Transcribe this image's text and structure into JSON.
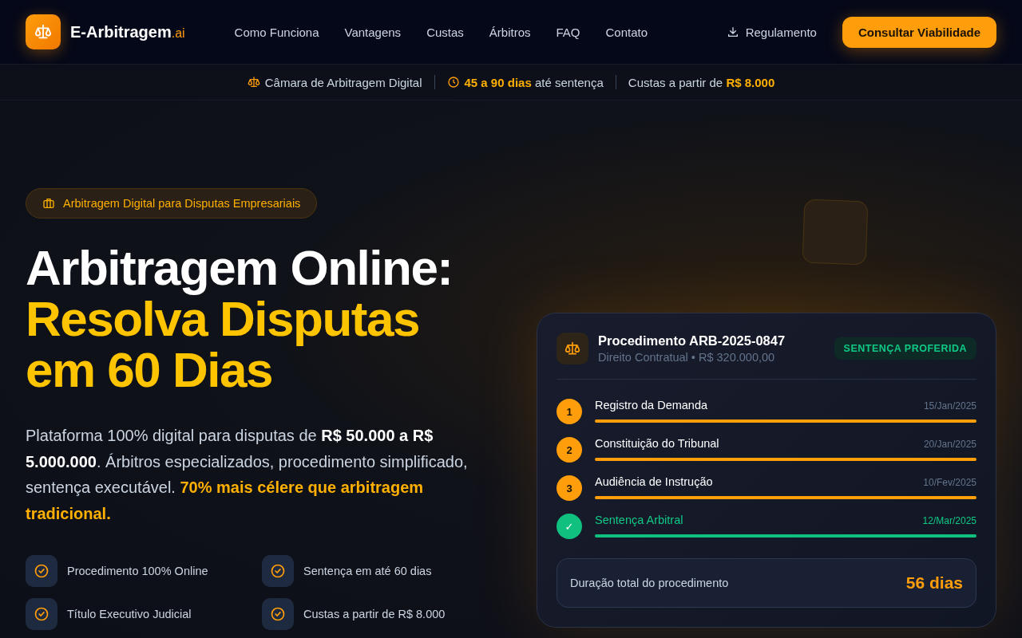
{
  "brand": {
    "name": "E-Arbitragem",
    "suffix": ".ai"
  },
  "nav": [
    {
      "label": "Como Funciona"
    },
    {
      "label": "Vantagens"
    },
    {
      "label": "Custas"
    },
    {
      "label": "Árbitros"
    },
    {
      "label": "FAQ"
    },
    {
      "label": "Contato"
    }
  ],
  "download_link": "Regulamento",
  "cta_button": "Consultar Viabilidade",
  "info_bar": [
    {
      "kind": "scale",
      "text": "Câmara de Arbitragem Digital"
    },
    {
      "kind": "clock",
      "text": "**45 a 90 dias** até sentença"
    },
    {
      "kind": "plain",
      "text": "Custas a partir de **R$ 8.000**"
    }
  ],
  "hero": {
    "badge": "Arbitragem Digital para Disputas Empresariais",
    "title_line": "Arbitragem Online:",
    "title_highlight": "Resolva Disputas em 60 Dias",
    "description": "Plataforma 100% digital para disputas de **R$ 50.000 a R$ 5.000.000**. Árbitros especializados, procedimento simplificado, sentença executável. **70% mais célere que arbitragem tradicional.**",
    "features": [
      {
        "label": "Procedimento 100% Online"
      },
      {
        "label": "Sentença em até 60 dias"
      },
      {
        "label": "Título Executivo Judicial"
      },
      {
        "label": "Custas a partir de R$ 8.000"
      }
    ]
  },
  "case_card": {
    "title": "Procedimento ARB-2025-0847",
    "subtitle": "Direito Contratual • R$ 320.000,00",
    "status": "SENTENÇA PROFERIDA",
    "steps": [
      {
        "kind": "number",
        "marker": "1",
        "label": "Registro da Demanda",
        "date": "15/Jan/2025",
        "level": 1
      },
      {
        "kind": "number",
        "marker": "2",
        "label": "Constituição do Tribunal",
        "date": "20/Jan/2025",
        "level": 1
      },
      {
        "kind": "number",
        "marker": "3",
        "label": "Audiência de Instrução",
        "date": "10/Fev/2025",
        "level": 1
      },
      {
        "kind": "done",
        "marker": "✓",
        "label": "Sentença Arbitral",
        "date": "12/Mar/2025",
        "level": 1
      }
    ],
    "total_label": "Duração total do procedimento",
    "total_value": "56 dias"
  }
}
